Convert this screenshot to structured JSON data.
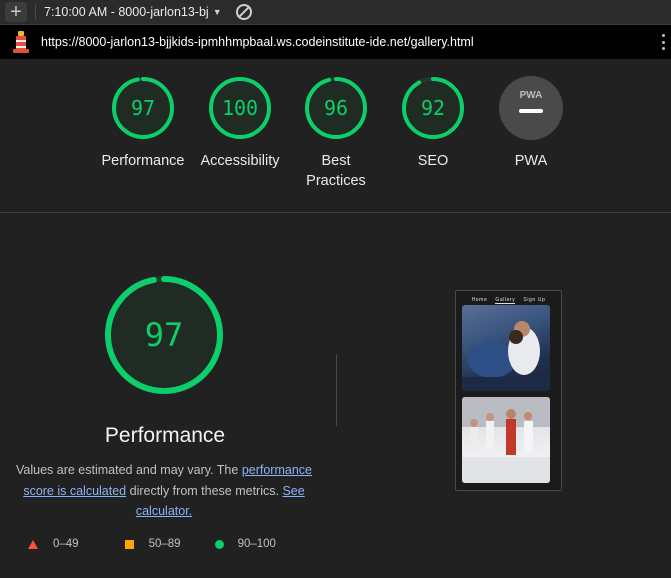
{
  "toolbar": {
    "timestamp_select": "7:10:00 AM - 8000-jarlon13-bj"
  },
  "url": "https://8000-jarlon13-bjjkids-ipmhhmpbaal.ws.codeinstitute-ide.net/gallery.html",
  "categories": [
    {
      "label": "Performance",
      "score": "97",
      "fraction": 0.97
    },
    {
      "label": "Accessibility",
      "score": "100",
      "fraction": 1.0
    },
    {
      "label": "Best Practices",
      "score": "96",
      "fraction": 0.96
    },
    {
      "label": "SEO",
      "score": "92",
      "fraction": 0.92
    },
    {
      "label": "PWA",
      "badge": "PWA"
    }
  ],
  "main": {
    "score": "97",
    "fraction": 0.97,
    "title": "Performance",
    "desc_text_1": "Values are estimated and may vary. The ",
    "desc_link_1": "performance score is calculated",
    "desc_text_2": " directly from these metrics. ",
    "desc_link_2": "See calculator."
  },
  "legend": [
    {
      "range": "0–49",
      "color": "#ff4e42"
    },
    {
      "range": "50–89",
      "color": "#ffa400"
    },
    {
      "range": "90–100",
      "color": "#0cce6b"
    }
  ],
  "thumbnail": {
    "nav": [
      "Home",
      "Gallery",
      "Sign Up"
    ]
  },
  "colors": {
    "pass": "#0cce6b",
    "background": "#212121",
    "link": "#8ab4f8"
  }
}
